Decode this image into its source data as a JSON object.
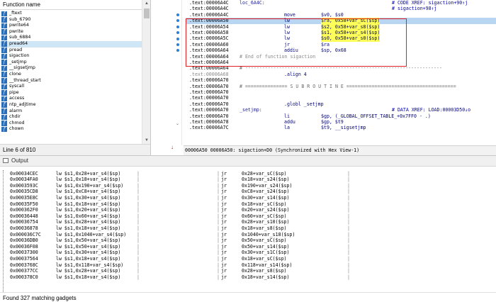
{
  "functions": {
    "header": "Function name",
    "items": [
      "_ftext",
      "sub_6790",
      "pwrite64",
      "pwrite",
      "sub_6884",
      "pread64",
      "pread",
      "sigaction",
      "_setjmp",
      "__sigsetjmp",
      "clone",
      "__thread_start",
      "syscall",
      "pipe",
      "access",
      "ntp_adjtime",
      "alarm",
      "chdir",
      "chmod",
      "chown"
    ],
    "selected_index": 5,
    "status": "Line 6 of 810"
  },
  "disasm": {
    "lines": [
      {
        "addr": ".text:00006A4C",
        "label": "loc_6A4C:",
        "xref": "# CODE XREF: sigaction+90↑j"
      },
      {
        "addr": ".text:00006A4C",
        "xref": "# sigaction+98↑j"
      },
      {
        "addr": ".text:00006A4C",
        "mn": "move",
        "op": "$v0, $s0"
      },
      {
        "addr": ".text:00006A50",
        "mn": "lw",
        "op": "$ra, 0x58+var_sC($sp)",
        "hl": true
      },
      {
        "addr": ".text:00006A54",
        "mn": "lw",
        "op": "$s2, 0x58+var_s8($sp)"
      },
      {
        "addr": ".text:00006A58",
        "mn": "lw",
        "op": "$s1, 0x58+var_s4($sp)"
      },
      {
        "addr": ".text:00006A5C",
        "mn": "lw",
        "op": "$s0, 0x58+var_s0($sp)"
      },
      {
        "addr": ".text:00006A60",
        "mn": "jr",
        "op": "$ra"
      },
      {
        "addr": ".text:00006A64",
        "mn": "addiu",
        "op": "$sp, 0x68"
      },
      {
        "addr": ".text:00006A64",
        "end": "# End of function sigaction"
      },
      {
        "addr": ".text:00006A64"
      },
      {
        "addr": ".text:00006A64",
        "sep": "# ----------------------------------------------------------------------"
      },
      {
        "addr": ".text:00006A68",
        "addr_grey": true,
        "mn": ".align 4"
      },
      {
        "addr": ".text:00006A70"
      },
      {
        "addr": ".text:00006A70",
        "sep": "# =============== S U B R O U T I N E ======================================="
      },
      {
        "addr": ".text:00006A70"
      },
      {
        "addr": ".text:00006A70"
      },
      {
        "addr": ".text:00006A70",
        "mn": ".globl _setjmp"
      },
      {
        "addr": ".text:00006A70",
        "label": "_setjmp:",
        "xref": "# DATA XREF: LOAD:00003D50↓o"
      },
      {
        "addr": ".text:00006A70",
        "mn": "li",
        "op": "$gp, (_GLOBAL_OFFSET_TABLE_+0x7FF0 - .)"
      },
      {
        "addr": ".text:00006A78",
        "mn": "addu",
        "op": "$gp, $t9"
      },
      {
        "addr": ".text:00006A7C",
        "mn": "la",
        "op": "$t9, __sigsetjmp"
      }
    ],
    "status": "00006A50 00006A50: sigaction+D0 (Synchronized with Hex View-1)"
  },
  "output": {
    "title": "Output",
    "gadgets": [
      [
        "0x00034CEC",
        "lw $s1,0x28+var_s4($sp)",
        "jr",
        "0x28+var_sC($sp)"
      ],
      [
        "0x00034FA0",
        "lw $s1,0x18+var_s4($sp)",
        "jr",
        "0x18+var_s24($sp)"
      ],
      [
        "0x0003593C",
        "lw $s1,0x190+var_s4($sp)",
        "jr",
        "0x190+var_s24($sp)"
      ],
      [
        "0x00035CD8",
        "lw $s1,0xC8+var_s4($sp)",
        "jr",
        "0xC8+var_s24($sp)"
      ],
      [
        "0x00035E8C",
        "lw $s1,0x30+var_s4($sp)",
        "jr",
        "0x30+var_s14($sp)"
      ],
      [
        "0x00035F50",
        "lw $s1,0x18+var_s4($sp)",
        "jr",
        "0x18+var_sC($sp)"
      ],
      [
        "0x000362F0",
        "lw $s1,0x20+var_s4($sp)",
        "jr",
        "0x20+var_s24($sp)"
      ],
      [
        "0x00036448",
        "lw $s1,0x60+var_s4($sp)",
        "jr",
        "0x60+var_sC($sp)"
      ],
      [
        "0x00036754",
        "lw $s1,0x28+var_s4($sp)",
        "jr",
        "0x28+var_s10($sp)"
      ],
      [
        "0x00036878",
        "lw $s1,0x18+var_s4($sp)",
        "jr",
        "0x18+var_s8($sp)"
      ],
      [
        "0x000036C7C",
        "lw $s1,0x1040+var_s4($sp)",
        "jr",
        "0x1040+var_s18($sp)"
      ],
      [
        "0x00036DB0",
        "lw $s1,0x50+var_s4($sp)",
        "jr",
        "0x50+var_sC($sp)"
      ],
      [
        "0x00036F08",
        "lw $s1,0x50+var_s4($sp)",
        "jr",
        "0x50+var_s14($sp)"
      ],
      [
        "0x00037300",
        "lw $s1,0x30+var_s4($sp)",
        "jr",
        "0x30+var_s1C($sp)"
      ],
      [
        "0x00037564",
        "lw $s1,0x18+var_s4($sp)",
        "jr",
        "0x18+var_sC($sp)"
      ],
      [
        "0x0003768C",
        "lw $s1,0x118+var_s4($sp)",
        "jr",
        "0x118+var_s14($sp)"
      ],
      [
        "0x000377CC",
        "lw $s1,0x28+var_s4($sp)",
        "jr",
        "0x28+var_s8($sp)"
      ],
      [
        "0x000378C0",
        "lw $s1,0x18+var_s4($sp)",
        "jr",
        "0x18+var_s14($sp)"
      ]
    ],
    "status": "Found 327 matching gadgets"
  }
}
